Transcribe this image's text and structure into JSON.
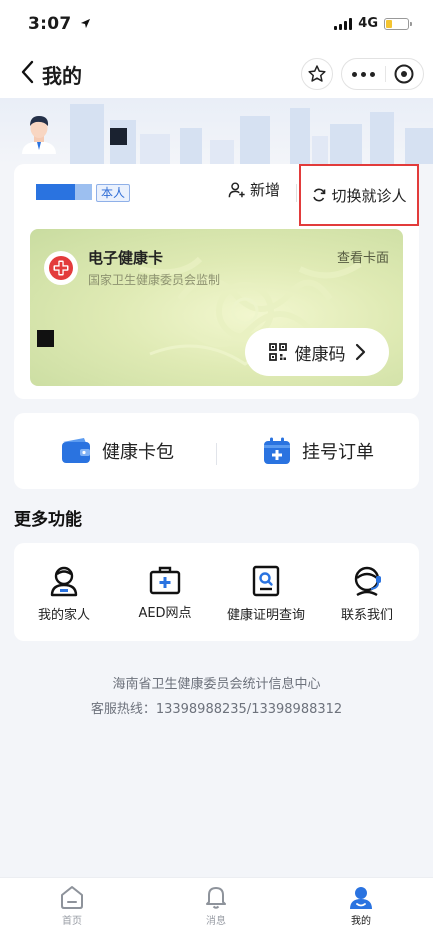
{
  "status_bar": {
    "time": "3:07",
    "network": "4G"
  },
  "nav": {
    "title": "我的"
  },
  "user_card": {
    "self_tag": "本人",
    "add_label": "新增",
    "switch_label": "切换就诊人"
  },
  "health_card": {
    "title": "电子健康卡",
    "subtitle": "国家卫生健康委员会监制",
    "view_face": "查看卡面",
    "code_button": "健康码"
  },
  "quick_actions": [
    {
      "label": "健康卡包",
      "icon": "wallet-icon"
    },
    {
      "label": "挂号订单",
      "icon": "calendar-plus-icon"
    }
  ],
  "more_functions": {
    "title": "更多功能",
    "items": [
      {
        "label": "我的家人",
        "icon": "family-member-icon"
      },
      {
        "label": "AED网点",
        "icon": "first-aid-kit-icon"
      },
      {
        "label": "健康证明查询",
        "icon": "certificate-search-icon"
      },
      {
        "label": "联系我们",
        "icon": "customer-service-icon"
      }
    ]
  },
  "footer": {
    "org": "海南省卫生健康委员会统计信息中心",
    "hotline": "客服热线：13398988235/13398988312"
  },
  "tabbar": [
    {
      "label": "首页",
      "icon": "home-icon"
    },
    {
      "label": "消息",
      "icon": "bell-icon"
    },
    {
      "label": "我的",
      "icon": "profile-icon",
      "active": true
    }
  ],
  "colors": {
    "accent": "#2a73e0",
    "highlight_border": "#e23b3b",
    "health_card_bg": "#dfeab4"
  }
}
